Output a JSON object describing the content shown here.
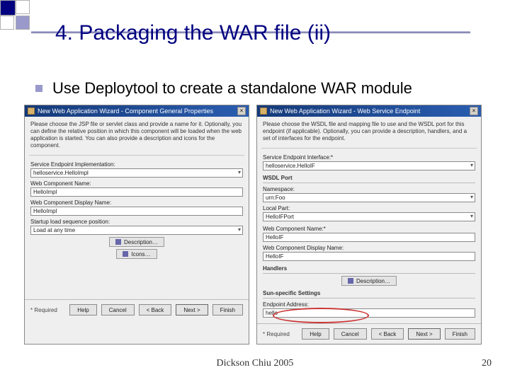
{
  "title": "4. Packaging the WAR file (ii)",
  "bullet": "Use Deploytool to create a standalone WAR module",
  "left": {
    "titlebar": "New Web Application Wizard - Component General Properties",
    "desc": "Please choose the JSP file or servlet class and provide a name for it. Optionally, you can define the relative position in which this component will be loaded when the web application is started. You can also provide a description and icons for the component.",
    "serviceEndpointLabel": "Service Endpoint Implementation:",
    "serviceEndpointVal": "helloservice.HelloImpl",
    "webCompNameLabel": "Web Component Name:",
    "webCompNameVal": "HelloImpl",
    "webCompDispLabel": "Web Component Display Name:",
    "webCompDispVal": "HelloImpl",
    "startupLabel": "Startup load sequence position:",
    "startupVal": "Load at any time",
    "descBtn": "Description…",
    "iconsBtn": "Icons…"
  },
  "right": {
    "titlebar": "New Web Application Wizard - Web Service Endpoint",
    "desc": "Please choose the WSDL file and mapping file to use and the WSDL port for this endpoint (if applicable). Optionally, you can provide a description, handlers, and a set of interfaces for the endpoint.",
    "seInterfaceLabel": "Service Endpoint Interface:*",
    "seInterfaceVal": "helloservice.HelloIF",
    "wsdlPortHead": "WSDL Port",
    "nsLabel": "Namespace:",
    "nsVal": "urn:Foo",
    "localLabel": "Local Part:",
    "localVal": "HelloIFPort",
    "webCompNameLabel": "Web Component Name:*",
    "webCompNameVal": "HelloIF",
    "webCompDispLabel": "Web Component Display Name:",
    "webCompDispVal": "HelloIF",
    "handlersHead": "Handlers",
    "descBtn": "Description…",
    "sunHead": "Sun-specific Settings",
    "endpointAddrLabel": "Endpoint Address:",
    "endpointAddrVal": "hello"
  },
  "buttons": {
    "required": "* Required",
    "help": "Help",
    "cancel": "Cancel",
    "back": "< Back",
    "next": "Next >",
    "finish": "Finish"
  },
  "credit": "Dickson Chiu 2005",
  "page": "20"
}
